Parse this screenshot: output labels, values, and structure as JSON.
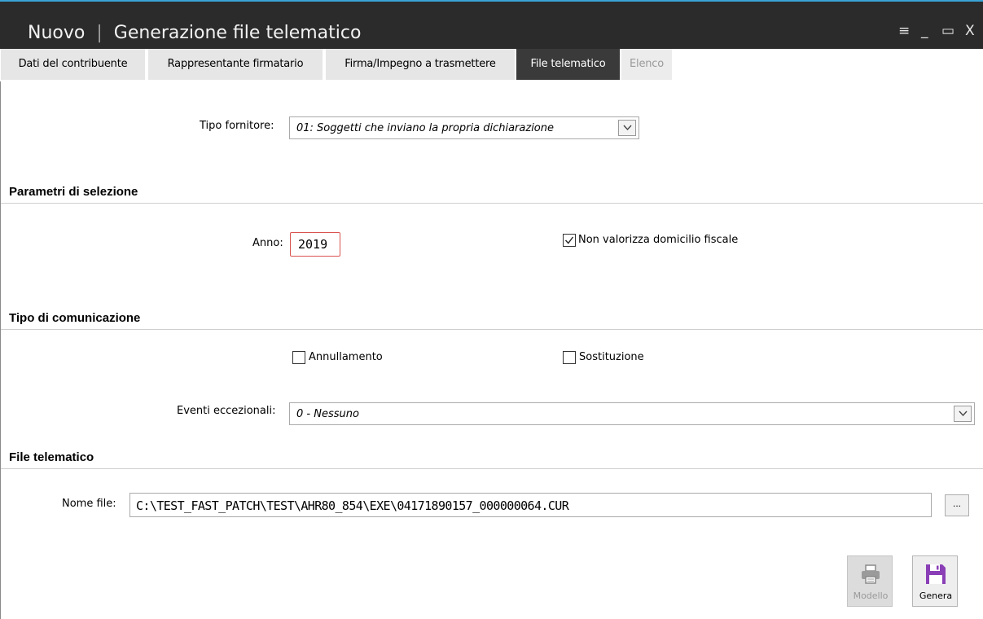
{
  "window": {
    "mode": "Nuovo",
    "separator": "|",
    "title": "Generazione file telematico",
    "controls": {
      "menu": "≡",
      "minimize": "_",
      "maximize": "▭",
      "close": "X"
    },
    "accent_color": "#3aa3d6"
  },
  "tabs": [
    {
      "label": "Dati del contribuente",
      "state": "normal"
    },
    {
      "label": "Rappresentante firmatario",
      "state": "normal"
    },
    {
      "label": "Firma/Impegno a trasmettere",
      "state": "normal"
    },
    {
      "label": "File telematico",
      "state": "active"
    },
    {
      "label": "Elenco",
      "state": "disabled"
    }
  ],
  "tipo_fornitore": {
    "label": "Tipo fornitore:",
    "value": "01: Soggetti che inviano la propria dichiarazione"
  },
  "sections": {
    "parametri": "Parametri di selezione",
    "tipo_comunicazione": "Tipo di comunicazione",
    "file_telematico": "File telematico"
  },
  "anno": {
    "label": "Anno:",
    "value": "2019"
  },
  "checkboxes": {
    "non_valorizza": {
      "label": "Non valorizza domicilio fiscale",
      "checked": true
    },
    "annullamento": {
      "label": "Annullamento",
      "checked": false
    },
    "sostituzione": {
      "label": "Sostituzione",
      "checked": false
    }
  },
  "eventi": {
    "label": "Eventi eccezionali:",
    "value": "0 - Nessuno"
  },
  "nome_file": {
    "label": "Nome file:",
    "value": "C:\\TEST_FAST_PATCH\\TEST\\AHR80_854\\EXE\\04171890157_000000064.CUR",
    "browse_label": "..."
  },
  "buttons": {
    "modello": {
      "label": "Modello",
      "enabled": false,
      "icon": "printer-icon"
    },
    "genera": {
      "label": "Genera",
      "enabled": true,
      "icon": "save-icon",
      "icon_color": "#8a3fb7"
    }
  }
}
